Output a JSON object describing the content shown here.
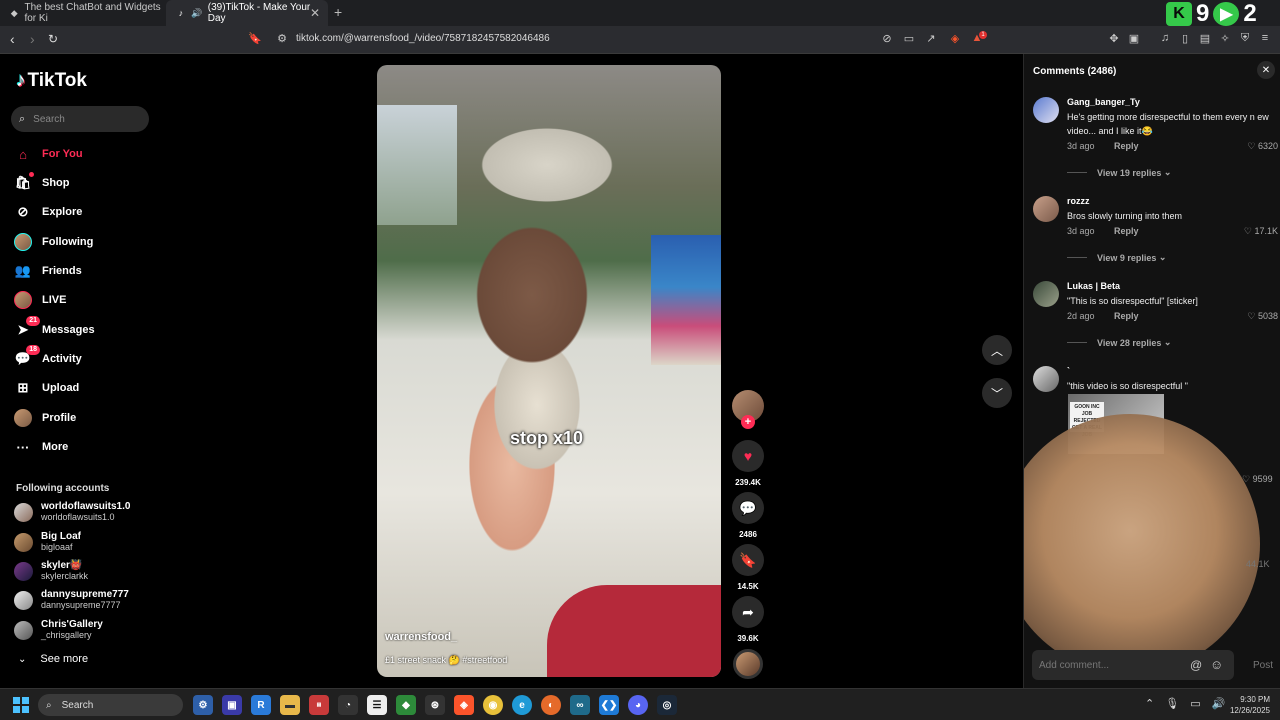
{
  "browser": {
    "tabs": [
      {
        "title": "The best ChatBot and Widgets for Ki",
        "active": false
      },
      {
        "title": "(39)TikTok - Make Your Day",
        "active": true
      }
    ],
    "new_tab": "+",
    "url": "tiktok.com/@warrensfood_/video/7587182457582046486",
    "ext_badge_1": "9",
    "ext_badge_2": "2",
    "brave_badge": "1"
  },
  "sidebar": {
    "logo": "TikTok",
    "search_placeholder": "Search",
    "nav": [
      {
        "label": "For You",
        "icon": "home-icon",
        "active": true
      },
      {
        "label": "Shop",
        "icon": "shop-icon",
        "active": false
      },
      {
        "label": "Explore",
        "icon": "compass-icon",
        "active": false
      },
      {
        "label": "Following",
        "icon": "following-avatar-icon",
        "active": false
      },
      {
        "label": "Friends",
        "icon": "friends-icon",
        "active": false
      },
      {
        "label": "LIVE",
        "icon": "live-icon",
        "active": false
      },
      {
        "label": "Messages",
        "icon": "messages-icon",
        "badge": "21",
        "active": false
      },
      {
        "label": "Activity",
        "icon": "activity-icon",
        "badge": "18",
        "active": false
      },
      {
        "label": "Upload",
        "icon": "upload-icon",
        "active": false
      },
      {
        "label": "Profile",
        "icon": "profile-avatar-icon",
        "active": false
      },
      {
        "label": "More",
        "icon": "more-icon",
        "active": false
      }
    ],
    "following_heading": "Following accounts",
    "accounts": [
      {
        "name": "worldoflawsuits1.0",
        "handle": "worldoflawsuits1.0"
      },
      {
        "name": "Big Loaf",
        "handle": "bigloaaf"
      },
      {
        "name": "skyler👹",
        "handle": "skylerclarkk"
      },
      {
        "name": "dannysupreme777",
        "handle": "dannysupreme7777"
      },
      {
        "name": "Chris'Gallery",
        "handle": "_chrisgallery"
      }
    ],
    "see_more": "See more"
  },
  "video": {
    "overlay_text": "stop x10",
    "author": "warrensfood_",
    "caption": "£1 street snack 🤔 #streetfood",
    "likes": "239.4K",
    "comments": "2486",
    "saves": "14.5K",
    "shares": "39.6K"
  },
  "comments_panel": {
    "title": "Comments (2486)",
    "items": [
      {
        "user": "Gang_banger_Ty",
        "text": "He's getting more disrespectful to them every n ew video... and I like it😂",
        "time": "3d ago",
        "reply": "Reply",
        "likes": "6320",
        "view_replies": "View 19 replies"
      },
      {
        "user": "rozzz",
        "text": "Bros slowly turning into them",
        "time": "3d ago",
        "reply": "Reply",
        "likes": "17.1K",
        "view_replies": "View 9 replies"
      },
      {
        "user": "Lukas | Beta",
        "text": "\"This is so disrespectful\" [sticker]",
        "time": "2d ago",
        "reply": "Reply",
        "likes": "5038",
        "view_replies": "View 28 replies"
      },
      {
        "user": "`",
        "text": "\"this video is so disrespectful \"",
        "likes": "9599"
      }
    ],
    "sticker_sign": "GOON INC JOB REJECTED GET A REAL JOB",
    "faint_likes": "44.1K",
    "input_placeholder": "Add comment...",
    "post": "Post"
  },
  "taskbar": {
    "search": "Search",
    "time": "9:30 PM",
    "date": "12/26/2025"
  },
  "colors": {
    "accent": "#fe2c55",
    "panel": "#121212"
  }
}
